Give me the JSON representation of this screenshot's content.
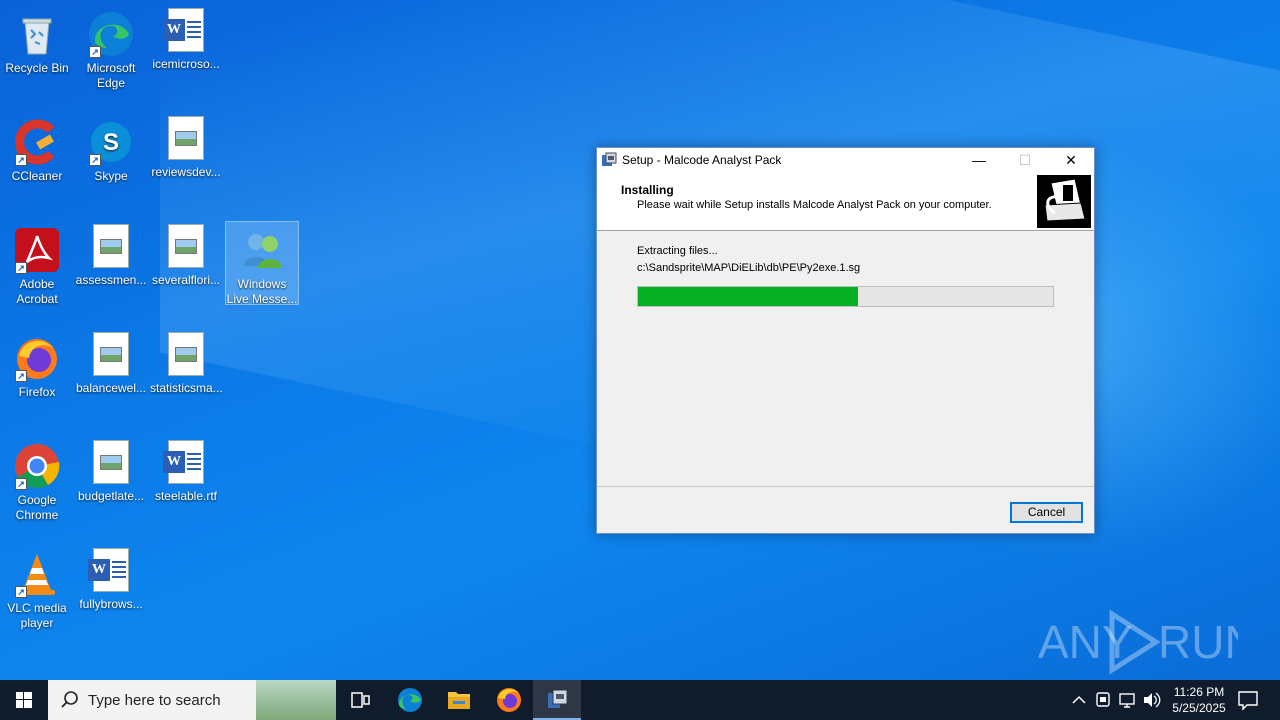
{
  "desktop": {
    "icons": [
      {
        "label": "Recycle Bin"
      },
      {
        "label": "Microsoft Edge"
      },
      {
        "label": "icemicroso..."
      },
      {
        "label": "CCleaner"
      },
      {
        "label": "Skype"
      },
      {
        "label": "reviewsdev..."
      },
      {
        "label": "Adobe Acrobat"
      },
      {
        "label": "assessmen..."
      },
      {
        "label": "severalflori..."
      },
      {
        "label": "Windows Live Messe..."
      },
      {
        "label": "Firefox"
      },
      {
        "label": "balancewel..."
      },
      {
        "label": "statisticsma..."
      },
      {
        "label": "Google Chrome"
      },
      {
        "label": "budgetlate..."
      },
      {
        "label": "steelable.rtf"
      },
      {
        "label": "VLC media player"
      },
      {
        "label": "fullybrows..."
      }
    ]
  },
  "dialog": {
    "title": "Setup - Malcode Analyst Pack",
    "header_title": "Installing",
    "header_subtitle": "Please wait while Setup installs Malcode Analyst Pack on your computer.",
    "status": "Extracting files...",
    "current_file": "c:\\Sandsprite\\MAP\\DiELib\\db\\PE\\Py2exe.1.sg",
    "progress": 0.53,
    "cancel_label": "Cancel",
    "minimize_glyph": "—",
    "maximize_glyph": "☐",
    "close_glyph": "✕"
  },
  "taskbar": {
    "search_placeholder": "Type here to search",
    "clock_time": "11:26 PM",
    "clock_date": "5/25/2025"
  },
  "watermark": {
    "text": "ANY RUN"
  },
  "colors": {
    "progress_fill": "#06b025",
    "taskbar": "#101c2c",
    "accent": "#0078d7"
  }
}
